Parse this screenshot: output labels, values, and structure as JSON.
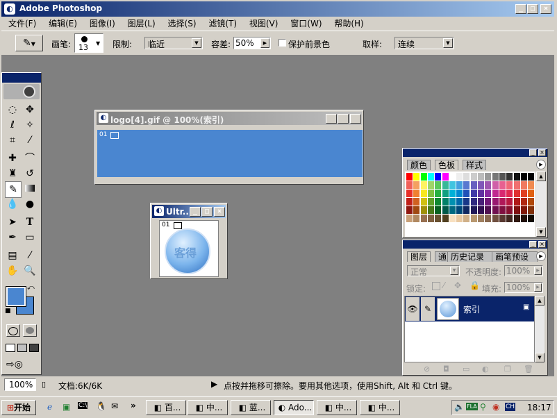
{
  "app": {
    "title": "Adobe Photoshop"
  },
  "menu": [
    "文件(F)",
    "编辑(E)",
    "图像(I)",
    "图层(L)",
    "选择(S)",
    "滤镜(T)",
    "视图(V)",
    "窗口(W)",
    "帮助(H)"
  ],
  "options": {
    "brush_label": "画笔:",
    "brush_size": "13",
    "limit_label": "限制:",
    "limit_value": "临近",
    "tolerance_label": "容差:",
    "tolerance_value": "50%",
    "protect_label": "保护前景色",
    "sampling_label": "取样:",
    "sampling_value": "连续"
  },
  "doc1": {
    "title": "logo[4].gif @ 100%(索引)",
    "layer_badge": "01"
  },
  "doc2": {
    "title": "Ultr...",
    "layer_badge": "01",
    "logo_text": "客得"
  },
  "color_panel": {
    "tabs": [
      "颜色",
      "色板",
      "样式"
    ]
  },
  "layers_panel": {
    "tabs": [
      "图层",
      "通道",
      "历史记录",
      "画笔预设"
    ],
    "blend_mode": "正常",
    "opacity_label": "不透明度:",
    "opacity_value": "100%",
    "lock_label": "锁定:",
    "fill_label": "填充:",
    "fill_value": "100%",
    "layer_name": "索引"
  },
  "status": {
    "zoom": "100%",
    "doc_info": "文档:6K/6K",
    "hint": "点按并拖移可擦除。要用其他选项，使用Shift, Alt 和 Ctrl 键。"
  },
  "taskbar": {
    "start_label": "开始",
    "tasks": [
      "百...",
      "中...",
      "蓝...",
      "Ado...",
      "中...",
      "中..."
    ],
    "time": "18:17",
    "tray_text": "FLA",
    "ime": "CH"
  },
  "colors": {
    "doc_blue": "#4a86d0",
    "foreground": "#4a86d0",
    "workspace": "#808080",
    "title_active": "#0a246a"
  }
}
